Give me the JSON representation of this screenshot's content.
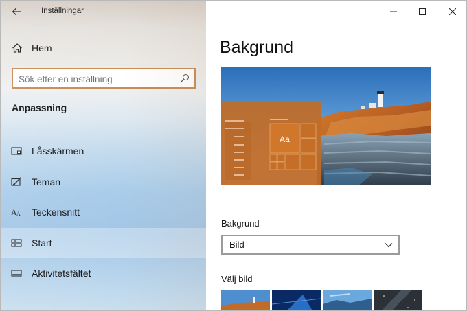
{
  "window": {
    "title": "Inställningar"
  },
  "sidebar": {
    "home_label": "Hem",
    "search_placeholder": "Sök efter en inställning",
    "section_title": "Anpassning",
    "items": [
      {
        "label": "Låsskärmen",
        "icon": "lock-screen-icon",
        "selected": false
      },
      {
        "label": "Teman",
        "icon": "themes-icon",
        "selected": false
      },
      {
        "label": "Teckensnitt",
        "icon": "fonts-icon",
        "selected": false
      },
      {
        "label": "Start",
        "icon": "start-icon",
        "selected": true
      },
      {
        "label": "Aktivitetsfältet",
        "icon": "taskbar-icon",
        "selected": false
      }
    ]
  },
  "main": {
    "page_title": "Bakgrund",
    "preview_sample_text": "Aa",
    "background_label": "Bakgrund",
    "background_value": "Bild",
    "choose_image_label": "Välj bild"
  },
  "colors": {
    "accent": "#c98a54",
    "tile_orange": "#c06a24",
    "selected_nav": "#ffffff52"
  }
}
